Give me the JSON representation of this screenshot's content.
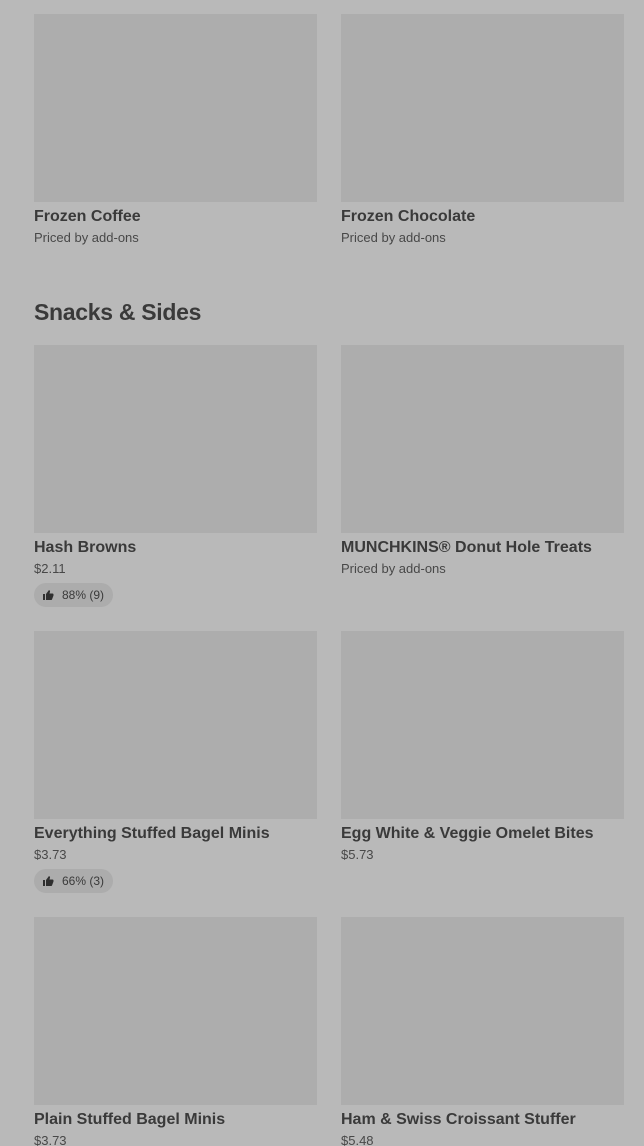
{
  "top_items": [
    {
      "name": "Frozen Coffee",
      "price": "Priced by add-ons"
    },
    {
      "name": "Frozen Chocolate",
      "price": "Priced by add-ons"
    }
  ],
  "section": {
    "title": "Snacks & Sides"
  },
  "items": [
    {
      "name": "Hash Browns",
      "price": "$2.11",
      "rating": "88% (9)",
      "rating_icon": "thumbs-up-icon"
    },
    {
      "name": "MUNCHKINS® Donut Hole Treats",
      "price": "Priced by add-ons"
    },
    {
      "name": "Everything Stuffed Bagel Minis",
      "price": "$3.73",
      "rating": "66% (3)",
      "rating_icon": "thumbs-up-icon"
    },
    {
      "name": "Egg White & Veggie Omelet Bites",
      "price": "$5.73"
    },
    {
      "name": "Plain Stuffed Bagel Minis",
      "price": "$3.73"
    },
    {
      "name": "Ham & Swiss Croissant Stuffer",
      "price": "$5.48"
    }
  ],
  "colors": {
    "background": "#b9b9b9",
    "placeholder": "#adadad",
    "text": "#3a3a3a"
  }
}
